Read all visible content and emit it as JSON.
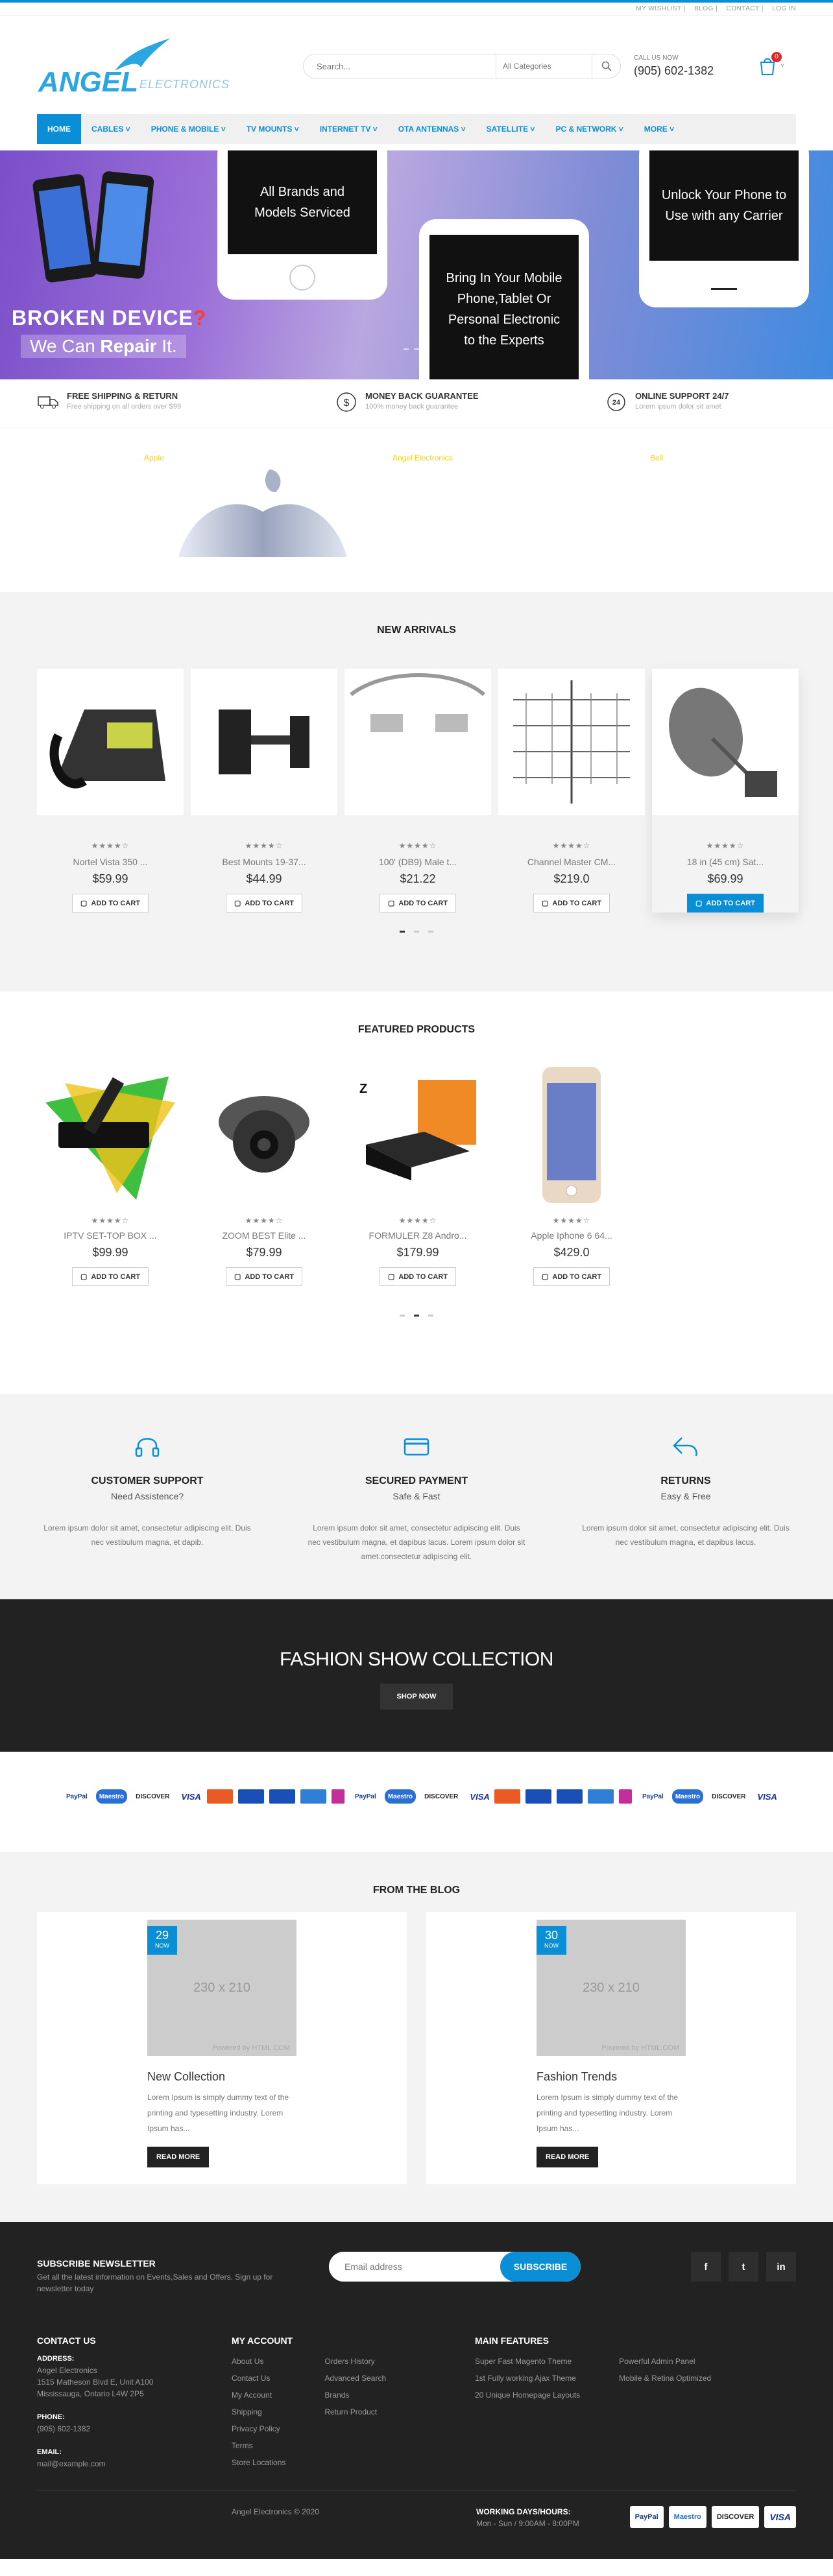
{
  "topbar": {
    "links": [
      "MY WISHLIST",
      "BLOG",
      "CONTACT",
      "LOG IN"
    ]
  },
  "header": {
    "logo_brand": "ANGEL",
    "logo_sub": "ELECTRONICS",
    "search_placeholder": "Search...",
    "search_category": "All Categories",
    "call_label": "CALL US NOW",
    "call_number": "(905) 602-1382",
    "cart_count": "0"
  },
  "nav": [
    {
      "label": "HOME",
      "active": true
    },
    {
      "label": "CABLES ˅"
    },
    {
      "label": "PHONE & MOBILE ˅"
    },
    {
      "label": "TV MOUNTS ˅"
    },
    {
      "label": "INTERNET TV ˅"
    },
    {
      "label": "OTA ANTENNAS ˅"
    },
    {
      "label": "SATELLITE ˅"
    },
    {
      "label": "PC & NETWORK ˅"
    },
    {
      "label": "MORE ˅"
    }
  ],
  "hero": {
    "card1": "All Brands and Models Serviced",
    "card2": "Bring In Your Mobile Phone,Tablet Or Personal Electronic to the Experts",
    "card3": "Unlock Your Phone to Use with any Carrier",
    "headline": "BROKEN DEVICE",
    "headline_mark": "?",
    "sub": "We Can",
    "sub_bold": "Repair",
    "sub_end": "It."
  },
  "policies": [
    {
      "title": "FREE SHIPPING & RETURN",
      "sub": "Free shipping on all orders over $99",
      "icon": "truck-icon"
    },
    {
      "title": "MONEY BACK GUARANTEE",
      "sub": "100% money back guarantee",
      "icon": "dollar-icon"
    },
    {
      "title": "ONLINE SUPPORT 24/7",
      "sub": "Lorem ipsum dolor sit amet",
      "icon": "24-support-icon"
    }
  ],
  "brands": [
    "Apple",
    "Angel Electronics",
    "Bell"
  ],
  "new_arrivals": {
    "title": "NEW ARRIVALS",
    "add_label": "ADD TO CART",
    "products": [
      {
        "name": "Nortel Vista 350 ...",
        "price": "$59.99",
        "rating": 4
      },
      {
        "name": "Best Mounts 19-37...",
        "price": "$44.99",
        "rating": 4
      },
      {
        "name": "100' (DB9) Male t...",
        "price": "$21.22",
        "rating": 4
      },
      {
        "name": "Channel Master CM...",
        "price": "$219.0",
        "rating": 4
      },
      {
        "name": "18 in (45 cm) Sat...",
        "price": "$69.99",
        "rating": 4
      }
    ]
  },
  "featured": {
    "title": "FEATURED PRODUCTS",
    "add_label": "ADD TO CART",
    "products": [
      {
        "name": "IPTV SET-TOP BOX ...",
        "price": "$99.99",
        "rating": 4
      },
      {
        "name": "ZOOM BEST Elite ...",
        "price": "$79.99",
        "rating": 4
      },
      {
        "name": "FORMULER Z8 Andro...",
        "price": "$179.99",
        "rating": 4
      },
      {
        "name": "Apple Iphone 6 64...",
        "price": "$429.0",
        "rating": 4
      }
    ]
  },
  "services": [
    {
      "title": "CUSTOMER SUPPORT",
      "sub": "Need Assistence?",
      "desc": "Lorem ipsum dolor sit amet, consectetur adipiscing elit. Duis nec vestibulum magna, et dapib.",
      "icon": "headset-icon"
    },
    {
      "title": "SECURED PAYMENT",
      "sub": "Safe & Fast",
      "desc": "Lorem ipsum dolor sit amet, consectetur adipiscing elit. Duis nec vestibulum magna, et dapibus lacus. Lorem ipsum dolor sit amet.consectetur adipiscing elit.",
      "icon": "credit-card-icon"
    },
    {
      "title": "RETURNS",
      "sub": "Easy & Free",
      "desc": "Lorem ipsum dolor sit amet, consectetur adipiscing elit. Duis nec vestibulum magna, et dapibus lacus.",
      "icon": "return-icon"
    }
  ],
  "fashion": {
    "title": "FASHION SHOW COLLECTION",
    "button": "SHOP NOW"
  },
  "blog": {
    "title": "FROM THE BLOG",
    "posts": [
      {
        "day": "29",
        "month": "NOW",
        "thumb": "230 x 210",
        "powered": "Powered by HTML.COM",
        "title": "New Collection",
        "text": "Lorem Ipsum is simply dummy text of the printing and typesetting industry. Lorem Ipsum has...",
        "button": "READ MORE"
      },
      {
        "day": "30",
        "month": "NOW",
        "thumb": "230 x 210",
        "powered": "Powered by HTML.COM",
        "title": "Fashion Trends",
        "text": "Lorem Ipsum is simply dummy text of the printing and typesetting industry. Lorem Ipsum has...",
        "button": "READ MORE"
      }
    ]
  },
  "footer": {
    "newsletter_title": "SUBSCRIBE NEWSLETTER",
    "newsletter_text": "Get all the latest information on Events,Sales and Offers. Sign up for newsletter today",
    "email_placeholder": "Email address",
    "subscribe": "SUBSCRIBE",
    "contact_title": "CONTACT US",
    "address_label": "ADDRESS:",
    "address": [
      "Angel Electronics",
      "1515 Matheson Blvd E, Unit A100",
      "Mississauga, Ontario L4W 2P5"
    ],
    "phone_label": "PHONE:",
    "phone": "(905) 602-1382",
    "email_label": "EMAIL:",
    "email": "mail@example.com",
    "account_title": "MY ACCOUNT",
    "account_col1": [
      "About Us",
      "Contact Us",
      "My Account",
      "Shipping",
      "Privacy Policy",
      "Terms",
      "Store Locations"
    ],
    "account_col2": [
      "Orders History",
      "Advanced Search",
      "Brands",
      "Return Product"
    ],
    "features_title": "MAIN FEATURES",
    "features_col1": [
      "Super Fast Magento Theme",
      "1st Fully working Ajax Theme",
      "20 Unique Homepage Layouts"
    ],
    "features_col2": [
      "Powerful Admin Panel",
      "Mobile & Retina Optimized"
    ],
    "copyright": "Angel Electronics © 2020",
    "hours_label": "WORKING DAYS/HOURS:",
    "hours": "Mon - Sun / 9:00AM - 8:00PM"
  },
  "payment_logos": [
    "PayPal",
    "Maestro",
    "DISCOVER",
    "VISA"
  ],
  "colors": {
    "accent": "#0a8fd6",
    "dark": "#222222",
    "light_bg": "#f3f3f3"
  }
}
